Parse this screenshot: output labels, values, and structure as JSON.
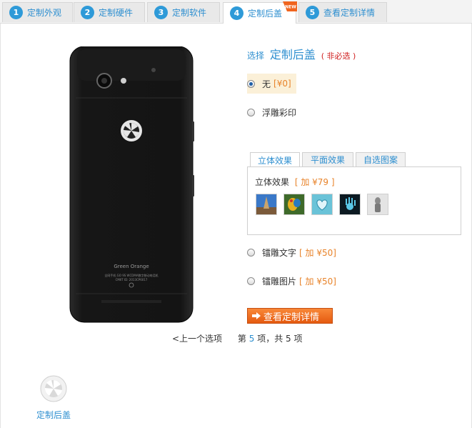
{
  "tabs": [
    {
      "num": "1",
      "label": "定制外观"
    },
    {
      "num": "2",
      "label": "定制硬件"
    },
    {
      "num": "3",
      "label": "定制软件"
    },
    {
      "num": "4",
      "label": "定制后盖",
      "badge": "NEW"
    },
    {
      "num": "5",
      "label": "查看定制详情"
    }
  ],
  "phone": {
    "brand": "Green Orange",
    "model_text": "全网手机 GO 9S  WCDMA数字移动电话机",
    "cmiit_text": "CMIIT ID: 2013CP6017"
  },
  "heading": {
    "select": "选择",
    "title": "定制后盖",
    "optional": "( 非必选 )"
  },
  "options": [
    {
      "label": "无",
      "price": "[¥0]"
    },
    {
      "label": "浮雕彩印"
    },
    {
      "label": "镭雕文字",
      "price": "[ 加 ¥50]"
    },
    {
      "label": "镭雕图片",
      "price": "[ 加 ¥50]"
    }
  ],
  "subtabs": [
    "立体效果",
    "平面效果",
    "自选图案"
  ],
  "panel": {
    "title": "立体效果",
    "price": "[ 加 ¥79 ]"
  },
  "cta_label": "查看定制详情",
  "pager": {
    "prev": "<上一个选项",
    "page_prefix": "第",
    "current": "5",
    "page_mid": "项，共",
    "total": "5",
    "page_suffix": "项"
  },
  "bottom": {
    "label": "定制后盖"
  },
  "colors": {
    "accent": "#2e8fd0",
    "price": "#e8832a",
    "required": "#d02020",
    "cta": "#f07020"
  }
}
